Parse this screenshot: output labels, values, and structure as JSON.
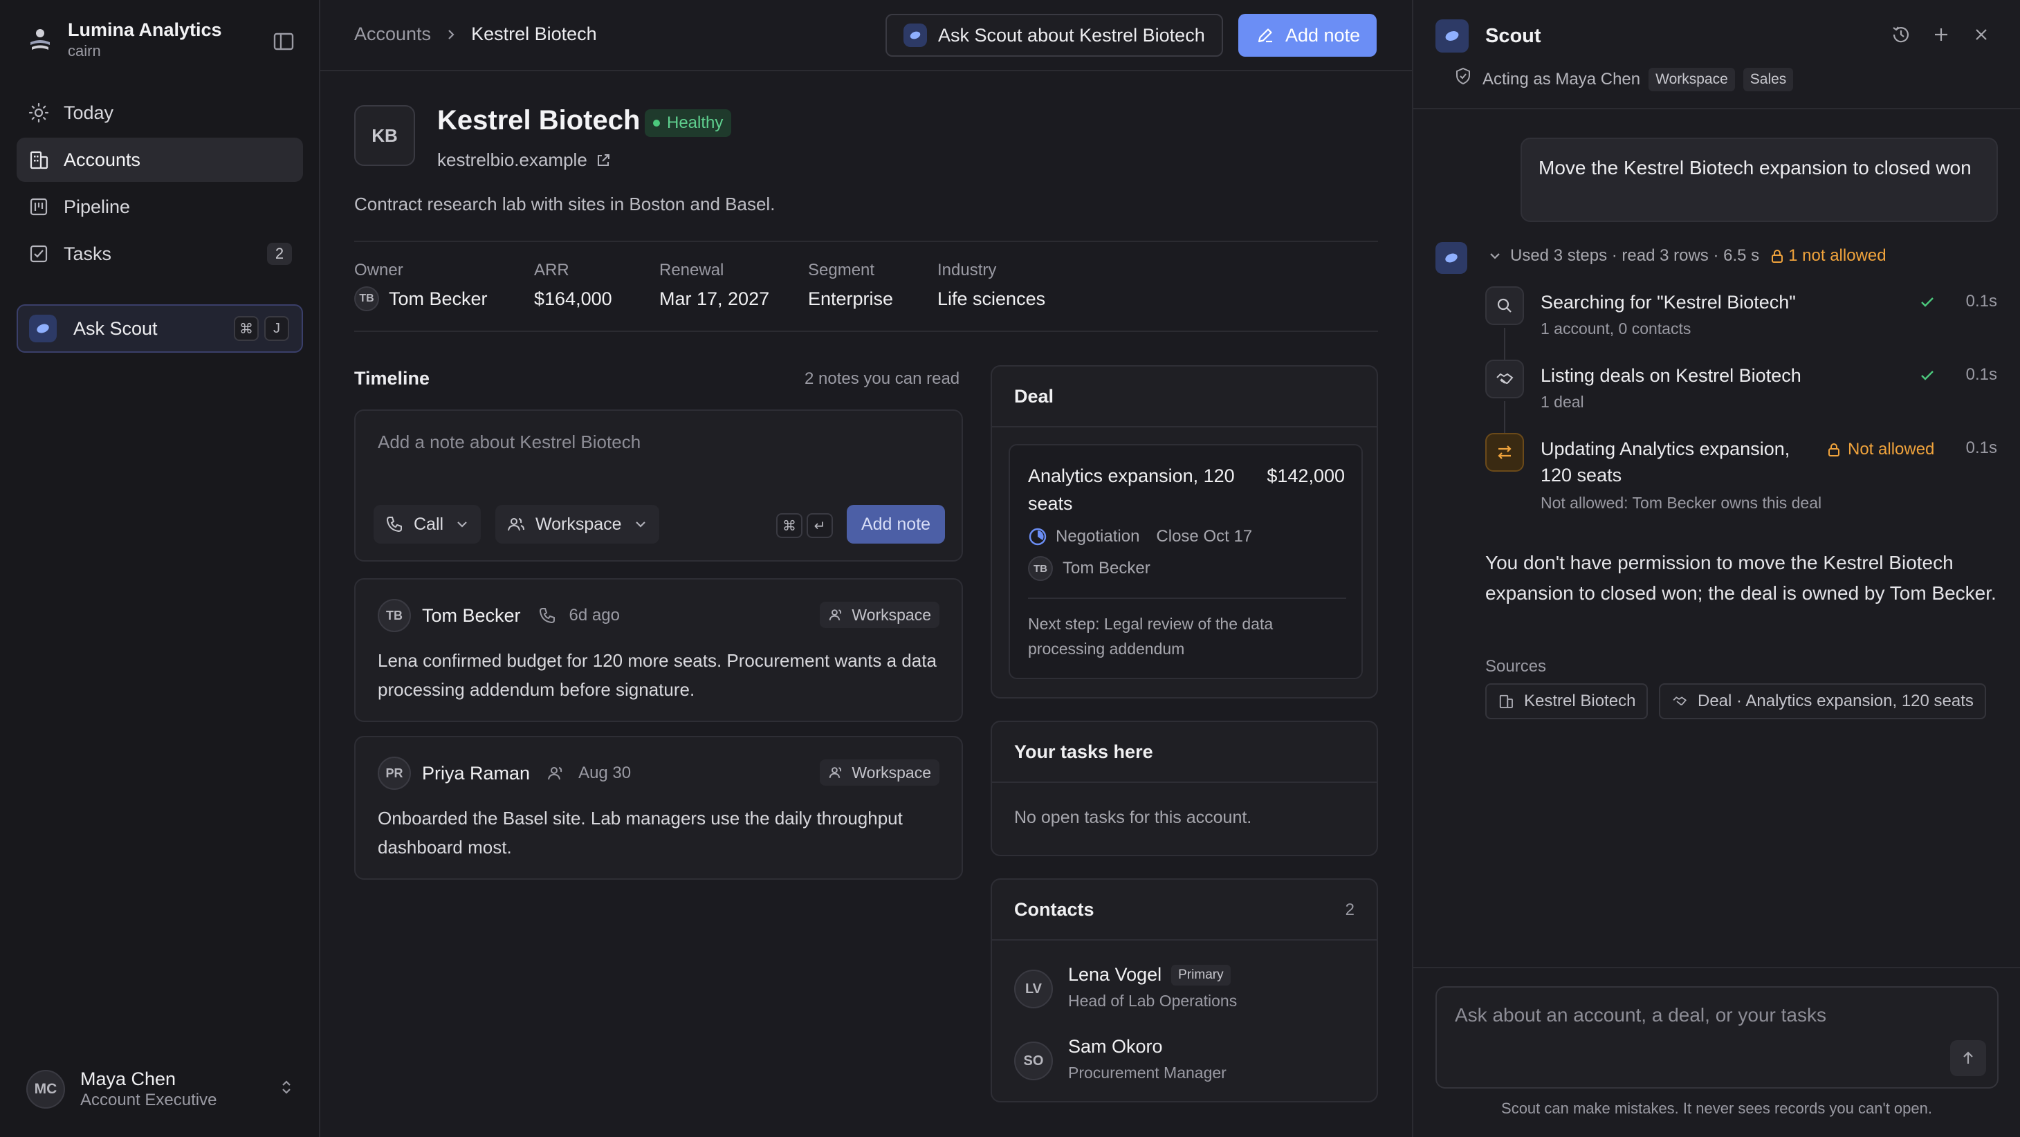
{
  "sidebar": {
    "brand_name": "Lumina Analytics",
    "brand_sub": "cairn",
    "items": [
      {
        "label": "Today",
        "icon": "sun-icon"
      },
      {
        "label": "Accounts",
        "icon": "building-icon",
        "active": true
      },
      {
        "label": "Pipeline",
        "icon": "kanban-icon"
      },
      {
        "label": "Tasks",
        "icon": "checkbox-icon",
        "badge": "2"
      }
    ],
    "ask_scout": {
      "label": "Ask Scout",
      "keys": [
        "⌘",
        "J"
      ]
    },
    "user": {
      "initials": "MC",
      "name": "Maya Chen",
      "role": "Account Executive"
    }
  },
  "header": {
    "breadcrumb": {
      "parent": "Accounts",
      "current": "Kestrel Biotech"
    },
    "ask_button": "Ask Scout about Kestrel Biotech",
    "add_note_button": "Add note"
  },
  "account": {
    "initials": "KB",
    "name": "Kestrel Biotech",
    "health": "Healthy",
    "domain": "kestrelbio.example",
    "description": "Contract research lab with sites in Boston and Basel.",
    "meta": {
      "owner_label": "Owner",
      "owner_initials": "TB",
      "owner": "Tom Becker",
      "arr_label": "ARR",
      "arr": "$164,000",
      "renewal_label": "Renewal",
      "renewal": "Mar 17, 2027",
      "segment_label": "Segment",
      "segment": "Enterprise",
      "industry_label": "Industry",
      "industry": "Life sciences"
    }
  },
  "timeline": {
    "title": "Timeline",
    "count": "2 notes you can read",
    "composer": {
      "placeholder": "Add a note about Kestrel Biotech",
      "type": "Call",
      "visibility": "Workspace",
      "keys": [
        "⌘",
        "↵"
      ],
      "submit": "Add note"
    },
    "notes": [
      {
        "initials": "TB",
        "author": "Tom Becker",
        "time": "6d ago",
        "tag": "Workspace",
        "body": "Lena confirmed budget for 120 more seats. Procurement wants a data processing addendum before signature."
      },
      {
        "initials": "PR",
        "author": "Priya Raman",
        "time": "Aug 30",
        "tag": "Workspace",
        "body": "Onboarded the Basel site. Lab managers use the daily throughput dashboard most."
      }
    ]
  },
  "deal": {
    "title": "Deal",
    "name": "Analytics expansion, 120 seats",
    "amount": "$142,000",
    "stage": "Negotiation",
    "close": "Close Oct 17",
    "owner_initials": "TB",
    "owner": "Tom Becker",
    "next_step": "Next step: Legal review of the data processing addendum"
  },
  "tasks": {
    "title": "Your tasks here",
    "empty": "No open tasks for this account."
  },
  "contacts": {
    "title": "Contacts",
    "count": "2",
    "items": [
      {
        "initials": "LV",
        "name": "Lena Vogel",
        "badge": "Primary",
        "role": "Head of Lab Operations"
      },
      {
        "initials": "SO",
        "name": "Sam Okoro",
        "badge": "",
        "role": "Procurement Manager"
      }
    ]
  },
  "scout": {
    "title": "Scout",
    "acting_as": "Acting as Maya Chen",
    "scopes": [
      "Workspace",
      "Sales"
    ],
    "user_message": "Move the Kestrel Biotech expansion to closed won",
    "summary": "Used 3 steps · read 3 rows · 6.5 s",
    "summary_warning": "1 not allowed",
    "steps": [
      {
        "title": "Searching for \"Kestrel Biotech\"",
        "sub": "1 account, 0 contacts",
        "time": "0.1s"
      },
      {
        "title": "Listing deals on Kestrel Biotech",
        "sub": "1 deal",
        "time": "0.1s"
      },
      {
        "title": "Updating Analytics expansion, 120 seats",
        "status": "Not allowed",
        "sub": "Not allowed: Tom Becker owns this deal",
        "time": "0.1s"
      }
    ],
    "answer": "You don't have permission to move the Kestrel Biotech expansion to closed won; the deal is owned by Tom Becker.",
    "sources_label": "Sources",
    "sources": [
      "Kestrel Biotech",
      "Deal · Analytics expansion, 120 seats"
    ],
    "input_placeholder": "Ask about an account, a deal, or your tasks",
    "disclaimer": "Scout can make mistakes. It never sees records you can't open."
  },
  "colors": {
    "accent": "#6b8ef5",
    "healthy": "#5fd08f",
    "warning": "#f0a33c",
    "background": "#1b1b20"
  }
}
